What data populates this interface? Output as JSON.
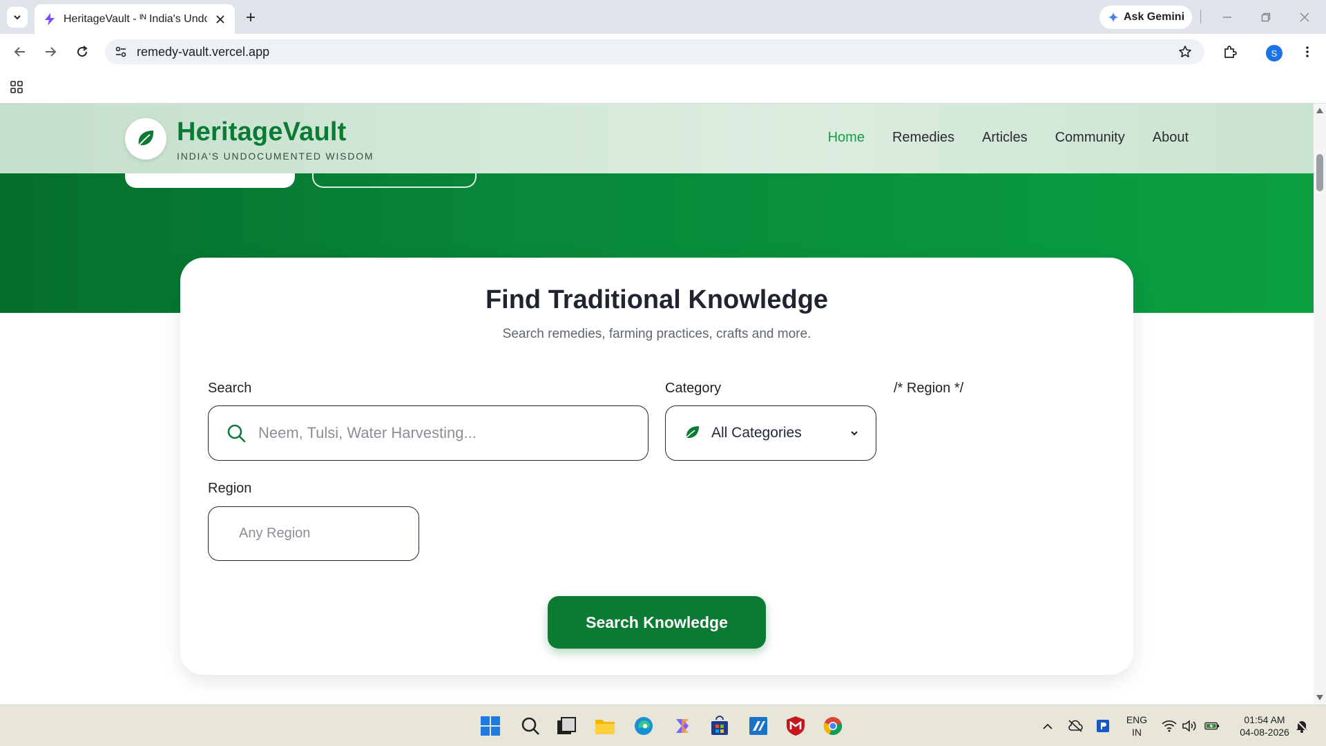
{
  "browser": {
    "tab_title": "HeritageVault - ᴵᴺ India's Undocumented Wisdom",
    "url": "remedy-vault.vercel.app",
    "gemini_label": "Ask Gemini",
    "profile_initial": "S"
  },
  "site": {
    "brand": "HeritageVault",
    "tagline": "INDIA'S UNDOCUMENTED WISDOM",
    "nav": [
      {
        "label": "Home",
        "active": true
      },
      {
        "label": "Remedies"
      },
      {
        "label": "Articles"
      },
      {
        "label": "Community"
      },
      {
        "label": "About"
      }
    ]
  },
  "search_card": {
    "title": "Find Traditional Knowledge",
    "subtitle": "Search remedies, farming practices, crafts and more.",
    "search_label": "Search",
    "search_placeholder": "Neem, Tulsi, Water Harvesting...",
    "category_label": "Category",
    "category_value": "All Categories",
    "comment_text": "/* Region */",
    "region_label": "Region",
    "region_placeholder": "Any Region",
    "submit_label": "Search Knowledge"
  },
  "taskbar": {
    "lang_top": "ENG",
    "lang_bottom": "IN",
    "time": "01:54 AM",
    "date": "04-08-2026"
  },
  "colors": {
    "brand_green": "#0b7a32",
    "nav_active": "#1a9a46",
    "hero_gradient_start": "#056f2c",
    "hero_gradient_end": "#0aa040"
  }
}
